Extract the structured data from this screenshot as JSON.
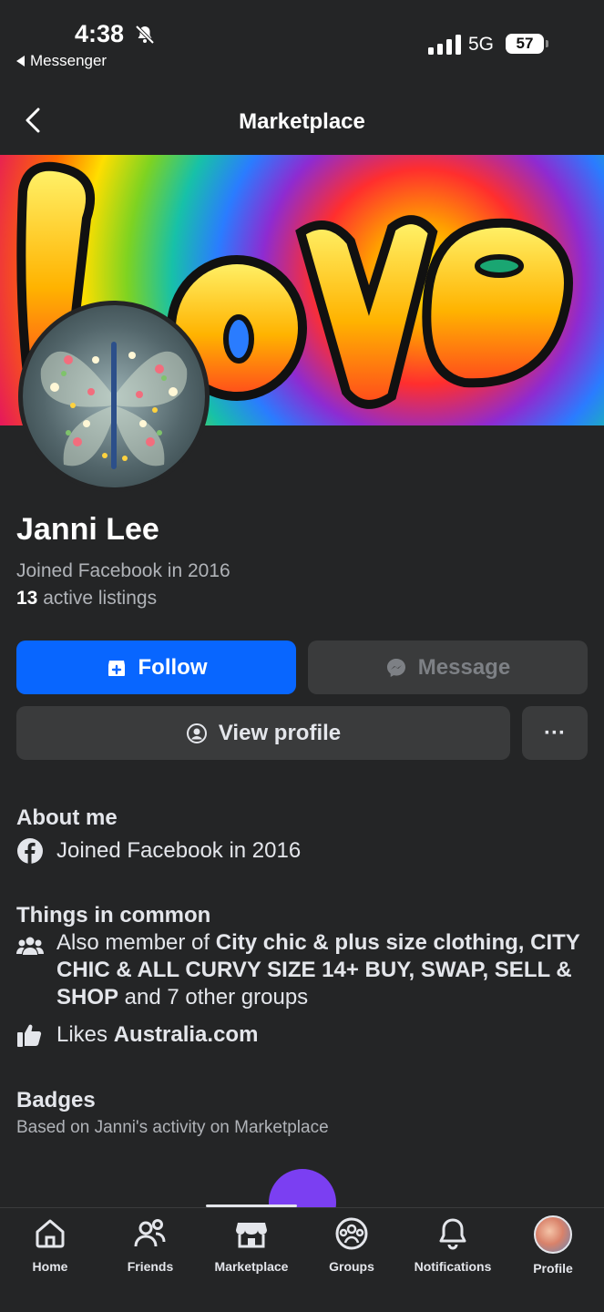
{
  "status_bar": {
    "time": "4:38",
    "back_app": "Messenger",
    "network": "5G",
    "battery": "57"
  },
  "header": {
    "title": "Marketplace"
  },
  "profile": {
    "name": "Janni Lee",
    "joined": "Joined Facebook in 2016",
    "listings_count": "13",
    "listings_label": " active listings"
  },
  "actions": {
    "follow": "Follow",
    "message": "Message",
    "view_profile": "View profile",
    "more": "···"
  },
  "about": {
    "title": "About me",
    "joined": "Joined Facebook in 2016"
  },
  "common": {
    "title": "Things in common",
    "groups_prefix": "Also member of ",
    "group1": "City chic & plus size clothing,",
    "group2": "CITY CHIC & ALL CURVY SIZE 14+ BUY, SWAP, SELL & SHOP",
    "groups_suffix": " and 7 other groups",
    "likes_prefix": "Likes ",
    "likes_page": "Australia.com"
  },
  "badges": {
    "title": "Badges",
    "subtitle": "Based on Janni's activity on Marketplace"
  },
  "tabs": [
    {
      "label": "Home",
      "icon": "home-icon"
    },
    {
      "label": "Friends",
      "icon": "friends-icon"
    },
    {
      "label": "Marketplace",
      "icon": "marketplace-icon"
    },
    {
      "label": "Groups",
      "icon": "groups-icon"
    },
    {
      "label": "Notifications",
      "icon": "bell-icon"
    },
    {
      "label": "Profile",
      "icon": "profile-avatar"
    }
  ],
  "colors": {
    "background": "#242526",
    "primary_button": "#0866ff",
    "secondary_button": "#3a3b3c",
    "fab": "#7b3ff2"
  }
}
